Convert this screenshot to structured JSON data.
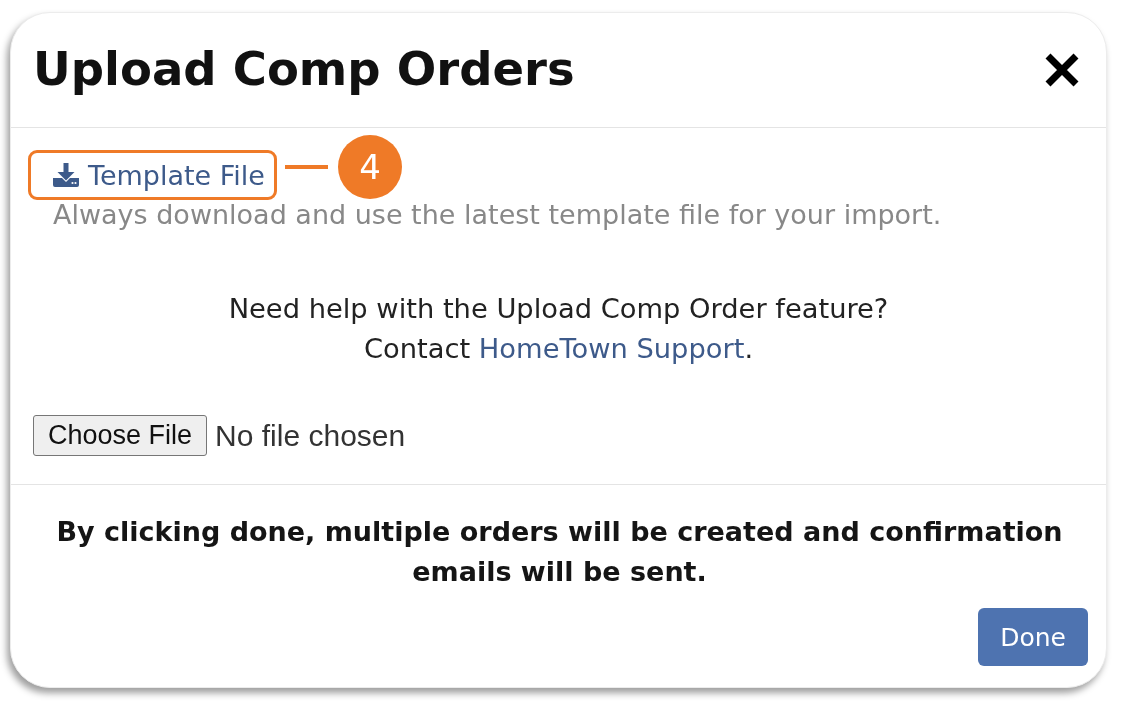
{
  "dialog": {
    "title": "Upload Comp Orders"
  },
  "template": {
    "link": "Template File",
    "note": "Always download and use the latest template file for your import."
  },
  "annotation": {
    "number": "4"
  },
  "help": {
    "question": "Need help with the Upload Comp Order feature?",
    "contact": "Contact",
    "link": "HomeTown Support",
    "end": "."
  },
  "file_input": {
    "button": "Choose File",
    "status": "No file chosen"
  },
  "footer": {
    "warning": "By clicking done, multiple orders will be created and confirmation emails will be sent.",
    "button": "Done"
  }
}
